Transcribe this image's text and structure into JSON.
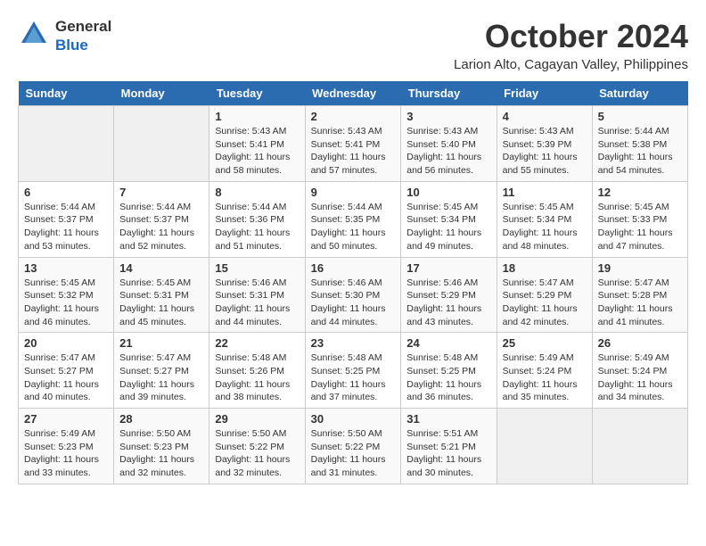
{
  "header": {
    "logo_line1": "General",
    "logo_line2": "Blue",
    "month_title": "October 2024",
    "location": "Larion Alto, Cagayan Valley, Philippines"
  },
  "weekdays": [
    "Sunday",
    "Monday",
    "Tuesday",
    "Wednesday",
    "Thursday",
    "Friday",
    "Saturday"
  ],
  "weeks": [
    [
      {
        "day": "",
        "sunrise": "",
        "sunset": "",
        "daylight": ""
      },
      {
        "day": "",
        "sunrise": "",
        "sunset": "",
        "daylight": ""
      },
      {
        "day": "1",
        "sunrise": "Sunrise: 5:43 AM",
        "sunset": "Sunset: 5:41 PM",
        "daylight": "Daylight: 11 hours and 58 minutes."
      },
      {
        "day": "2",
        "sunrise": "Sunrise: 5:43 AM",
        "sunset": "Sunset: 5:41 PM",
        "daylight": "Daylight: 11 hours and 57 minutes."
      },
      {
        "day": "3",
        "sunrise": "Sunrise: 5:43 AM",
        "sunset": "Sunset: 5:40 PM",
        "daylight": "Daylight: 11 hours and 56 minutes."
      },
      {
        "day": "4",
        "sunrise": "Sunrise: 5:43 AM",
        "sunset": "Sunset: 5:39 PM",
        "daylight": "Daylight: 11 hours and 55 minutes."
      },
      {
        "day": "5",
        "sunrise": "Sunrise: 5:44 AM",
        "sunset": "Sunset: 5:38 PM",
        "daylight": "Daylight: 11 hours and 54 minutes."
      }
    ],
    [
      {
        "day": "6",
        "sunrise": "Sunrise: 5:44 AM",
        "sunset": "Sunset: 5:37 PM",
        "daylight": "Daylight: 11 hours and 53 minutes."
      },
      {
        "day": "7",
        "sunrise": "Sunrise: 5:44 AM",
        "sunset": "Sunset: 5:37 PM",
        "daylight": "Daylight: 11 hours and 52 minutes."
      },
      {
        "day": "8",
        "sunrise": "Sunrise: 5:44 AM",
        "sunset": "Sunset: 5:36 PM",
        "daylight": "Daylight: 11 hours and 51 minutes."
      },
      {
        "day": "9",
        "sunrise": "Sunrise: 5:44 AM",
        "sunset": "Sunset: 5:35 PM",
        "daylight": "Daylight: 11 hours and 50 minutes."
      },
      {
        "day": "10",
        "sunrise": "Sunrise: 5:45 AM",
        "sunset": "Sunset: 5:34 PM",
        "daylight": "Daylight: 11 hours and 49 minutes."
      },
      {
        "day": "11",
        "sunrise": "Sunrise: 5:45 AM",
        "sunset": "Sunset: 5:34 PM",
        "daylight": "Daylight: 11 hours and 48 minutes."
      },
      {
        "day": "12",
        "sunrise": "Sunrise: 5:45 AM",
        "sunset": "Sunset: 5:33 PM",
        "daylight": "Daylight: 11 hours and 47 minutes."
      }
    ],
    [
      {
        "day": "13",
        "sunrise": "Sunrise: 5:45 AM",
        "sunset": "Sunset: 5:32 PM",
        "daylight": "Daylight: 11 hours and 46 minutes."
      },
      {
        "day": "14",
        "sunrise": "Sunrise: 5:45 AM",
        "sunset": "Sunset: 5:31 PM",
        "daylight": "Daylight: 11 hours and 45 minutes."
      },
      {
        "day": "15",
        "sunrise": "Sunrise: 5:46 AM",
        "sunset": "Sunset: 5:31 PM",
        "daylight": "Daylight: 11 hours and 44 minutes."
      },
      {
        "day": "16",
        "sunrise": "Sunrise: 5:46 AM",
        "sunset": "Sunset: 5:30 PM",
        "daylight": "Daylight: 11 hours and 44 minutes."
      },
      {
        "day": "17",
        "sunrise": "Sunrise: 5:46 AM",
        "sunset": "Sunset: 5:29 PM",
        "daylight": "Daylight: 11 hours and 43 minutes."
      },
      {
        "day": "18",
        "sunrise": "Sunrise: 5:47 AM",
        "sunset": "Sunset: 5:29 PM",
        "daylight": "Daylight: 11 hours and 42 minutes."
      },
      {
        "day": "19",
        "sunrise": "Sunrise: 5:47 AM",
        "sunset": "Sunset: 5:28 PM",
        "daylight": "Daylight: 11 hours and 41 minutes."
      }
    ],
    [
      {
        "day": "20",
        "sunrise": "Sunrise: 5:47 AM",
        "sunset": "Sunset: 5:27 PM",
        "daylight": "Daylight: 11 hours and 40 minutes."
      },
      {
        "day": "21",
        "sunrise": "Sunrise: 5:47 AM",
        "sunset": "Sunset: 5:27 PM",
        "daylight": "Daylight: 11 hours and 39 minutes."
      },
      {
        "day": "22",
        "sunrise": "Sunrise: 5:48 AM",
        "sunset": "Sunset: 5:26 PM",
        "daylight": "Daylight: 11 hours and 38 minutes."
      },
      {
        "day": "23",
        "sunrise": "Sunrise: 5:48 AM",
        "sunset": "Sunset: 5:25 PM",
        "daylight": "Daylight: 11 hours and 37 minutes."
      },
      {
        "day": "24",
        "sunrise": "Sunrise: 5:48 AM",
        "sunset": "Sunset: 5:25 PM",
        "daylight": "Daylight: 11 hours and 36 minutes."
      },
      {
        "day": "25",
        "sunrise": "Sunrise: 5:49 AM",
        "sunset": "Sunset: 5:24 PM",
        "daylight": "Daylight: 11 hours and 35 minutes."
      },
      {
        "day": "26",
        "sunrise": "Sunrise: 5:49 AM",
        "sunset": "Sunset: 5:24 PM",
        "daylight": "Daylight: 11 hours and 34 minutes."
      }
    ],
    [
      {
        "day": "27",
        "sunrise": "Sunrise: 5:49 AM",
        "sunset": "Sunset: 5:23 PM",
        "daylight": "Daylight: 11 hours and 33 minutes."
      },
      {
        "day": "28",
        "sunrise": "Sunrise: 5:50 AM",
        "sunset": "Sunset: 5:23 PM",
        "daylight": "Daylight: 11 hours and 32 minutes."
      },
      {
        "day": "29",
        "sunrise": "Sunrise: 5:50 AM",
        "sunset": "Sunset: 5:22 PM",
        "daylight": "Daylight: 11 hours and 32 minutes."
      },
      {
        "day": "30",
        "sunrise": "Sunrise: 5:50 AM",
        "sunset": "Sunset: 5:22 PM",
        "daylight": "Daylight: 11 hours and 31 minutes."
      },
      {
        "day": "31",
        "sunrise": "Sunrise: 5:51 AM",
        "sunset": "Sunset: 5:21 PM",
        "daylight": "Daylight: 11 hours and 30 minutes."
      },
      {
        "day": "",
        "sunrise": "",
        "sunset": "",
        "daylight": ""
      },
      {
        "day": "",
        "sunrise": "",
        "sunset": "",
        "daylight": ""
      }
    ]
  ]
}
